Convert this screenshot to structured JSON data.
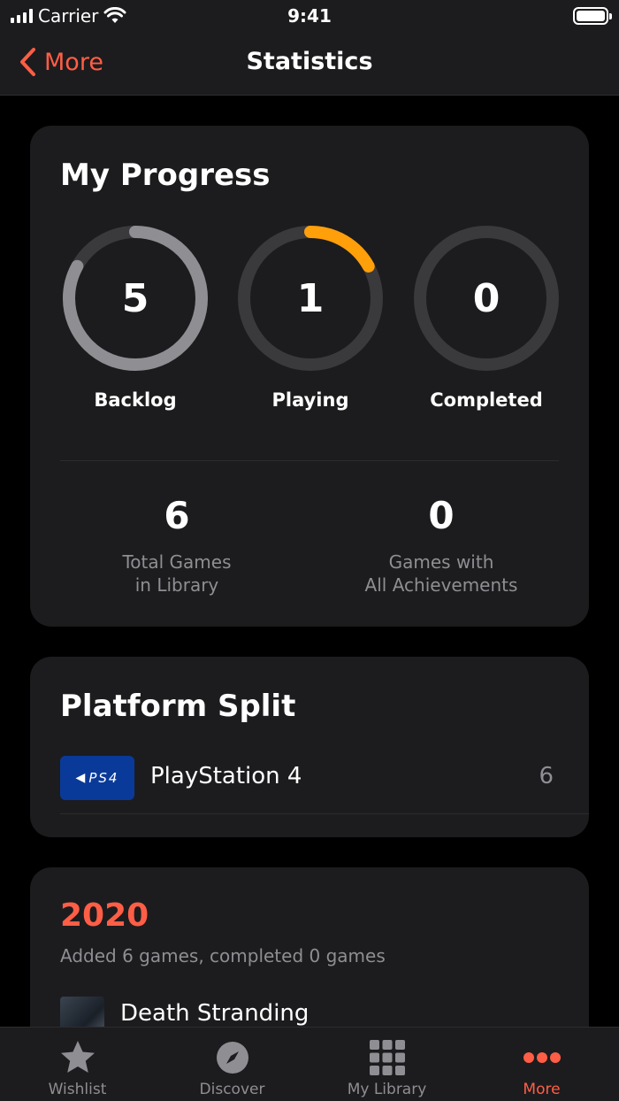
{
  "status_bar": {
    "carrier": "Carrier",
    "time": "9:41"
  },
  "nav": {
    "back_label": "More",
    "title": "Statistics"
  },
  "progress": {
    "title": "My Progress",
    "rings": [
      {
        "value": "5",
        "label": "Backlog",
        "fraction": 0.83,
        "color": "#8e8e93"
      },
      {
        "value": "1",
        "label": "Playing",
        "fraction": 0.17,
        "color": "#ff9f0a"
      },
      {
        "value": "0",
        "label": "Completed",
        "fraction": 0,
        "color": "#8e8e93"
      }
    ],
    "stats": [
      {
        "value": "6",
        "line1": "Total Games",
        "line2": "in Library"
      },
      {
        "value": "0",
        "line1": "Games with",
        "line2": "All Achievements"
      }
    ]
  },
  "platform_split": {
    "title": "Platform Split",
    "items": [
      {
        "name": "PlayStation 4",
        "count": "6",
        "logo_text": "PS4"
      }
    ]
  },
  "year_summary": {
    "year": "2020",
    "summary": "Added 6 games, completed 0 games",
    "games": [
      {
        "name": "Death Stranding"
      }
    ]
  },
  "tab_bar": {
    "tabs": [
      {
        "label": "Wishlist",
        "icon": "star-icon"
      },
      {
        "label": "Discover",
        "icon": "compass-icon"
      },
      {
        "label": "My Library",
        "icon": "grid-icon"
      },
      {
        "label": "More",
        "icon": "more-icon",
        "active": true
      }
    ]
  },
  "colors": {
    "accent": "#ff5e46",
    "playing": "#ff9f0a",
    "card": "#1c1c1e",
    "secondary_text": "#8e8e93",
    "ring_track": "#3a3a3c"
  }
}
